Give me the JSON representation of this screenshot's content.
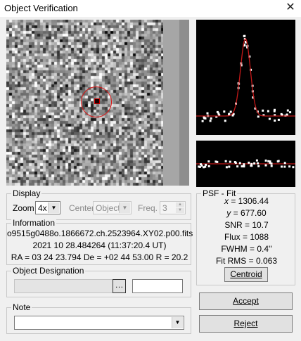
{
  "window": {
    "title": "Object Verification",
    "close_glyph": "✕"
  },
  "display": {
    "label": "Display",
    "zoom_label": "Zoom",
    "zoom_value": "4x",
    "center_label": "Center",
    "center_value": "Object",
    "freq_label": "Freq.",
    "freq_value": "3"
  },
  "information": {
    "label": "Information",
    "filename": "o9515g0488o.1866672.ch.2523964.XY02.p00.fits",
    "datetime": "2021 10 28.484264 (11:37:20.4 UT)",
    "coords": "RA = 03 24 23.794   De = +02 44 53.00   R = 20.2"
  },
  "designation": {
    "label": "Object Designation",
    "browse_glyph": "…"
  },
  "note": {
    "label": "Note"
  },
  "psf": {
    "label": "PSF - Fit",
    "x_key": "x",
    "x": "= 1306.44",
    "y_key": "y",
    "y": "= 677.60",
    "snr": "SNR = 10.7",
    "flux": "Flux = 1088",
    "fwhm": "FWHM = 0.4''",
    "fitrms": "Fit RMS = 0.063",
    "centroid": "Centroid"
  },
  "buttons": {
    "accept": "Accept",
    "reject": "Reject"
  }
}
